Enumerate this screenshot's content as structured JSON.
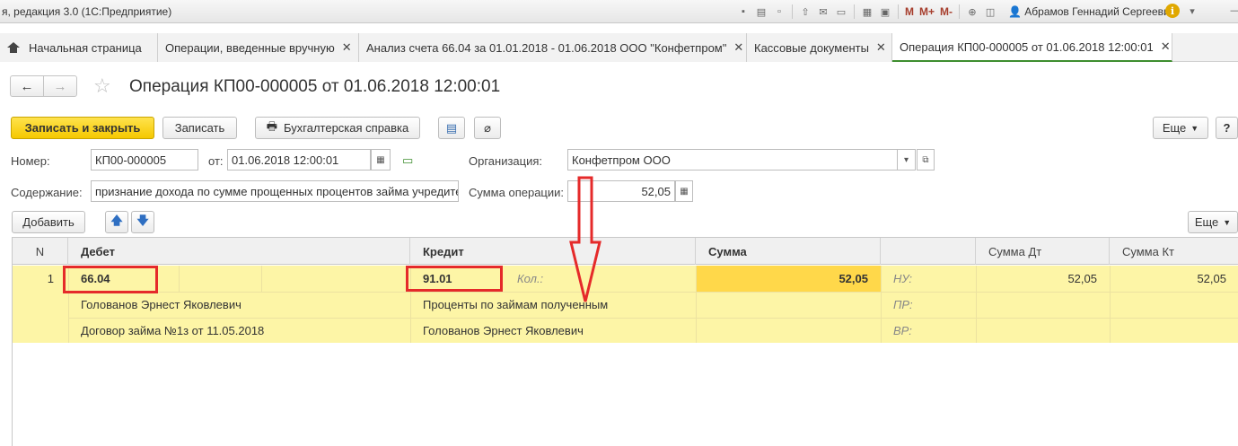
{
  "window": {
    "title": "я, редакция 3.0 (1С:Предприятие)",
    "user": "Абрамов Геннадий Сергеевич",
    "toolbar_m": [
      "M",
      "M+",
      "M-"
    ]
  },
  "tabs": [
    {
      "label": "Начальная страница",
      "closable": false
    },
    {
      "label": "Операции, введенные вручную",
      "closable": true
    },
    {
      "label": "Анализ счета 66.04 за 01.01.2018 - 01.06.2018 ООО \"Конфетпром\"",
      "closable": true
    },
    {
      "label": "Кассовые документы",
      "closable": true
    },
    {
      "label": "Операция КП00-000005 от 01.06.2018 12:00:01",
      "closable": true
    }
  ],
  "tab_close": "✕",
  "document": {
    "title": "Операция КП00-000005 от 01.06.2018 12:00:01"
  },
  "commands": {
    "save_close": "Записать и закрыть",
    "save": "Записать",
    "report": "Бухгалтерская справка",
    "more": "Еще",
    "help": "?"
  },
  "form": {
    "number_label": "Номер:",
    "number_value": "КП00-000005",
    "date_label": "от:",
    "date_value": "01.06.2018 12:00:01",
    "org_label": "Организация:",
    "org_value": "Конфетпром ООО",
    "content_label": "Содержание:",
    "content_value": "признание дохода по сумме прощенных процентов займа учредителя",
    "sum_label": "Сумма операции:",
    "sum_value": "52,05"
  },
  "table_toolbar": {
    "add": "Добавить",
    "more": "Еще"
  },
  "table": {
    "headers": {
      "n": "N",
      "debit": "Дебет",
      "credit": "Кредит",
      "sum": "Сумма",
      "sum_dt": "Сумма Дт",
      "sum_kt": "Сумма Кт"
    },
    "row": {
      "n": "1",
      "debit_account": "66.04",
      "debit_sub1": "Голованов Эрнест Яковлевич",
      "debit_sub2": "Договор займа №1з от 11.05.2018",
      "credit_account": "91.01",
      "qty_label": "Кол.:",
      "credit_sub1": "Проценты по займам полученным",
      "credit_sub2": "Голованов Эрнест Яковлевич",
      "sum": "52,05",
      "nu_label": "НУ:",
      "pr_label": "ПР:",
      "vr_label": "ВР:",
      "sum_dt": "52,05",
      "sum_kt": "52,05"
    }
  },
  "colors": {
    "primary_button": "#f5c800",
    "row_highlight": "#fdf5a6",
    "sum_cell": "#ffd84a",
    "annotation_red": "#e52a2a",
    "active_tab_accent": "#3e8e2f"
  }
}
